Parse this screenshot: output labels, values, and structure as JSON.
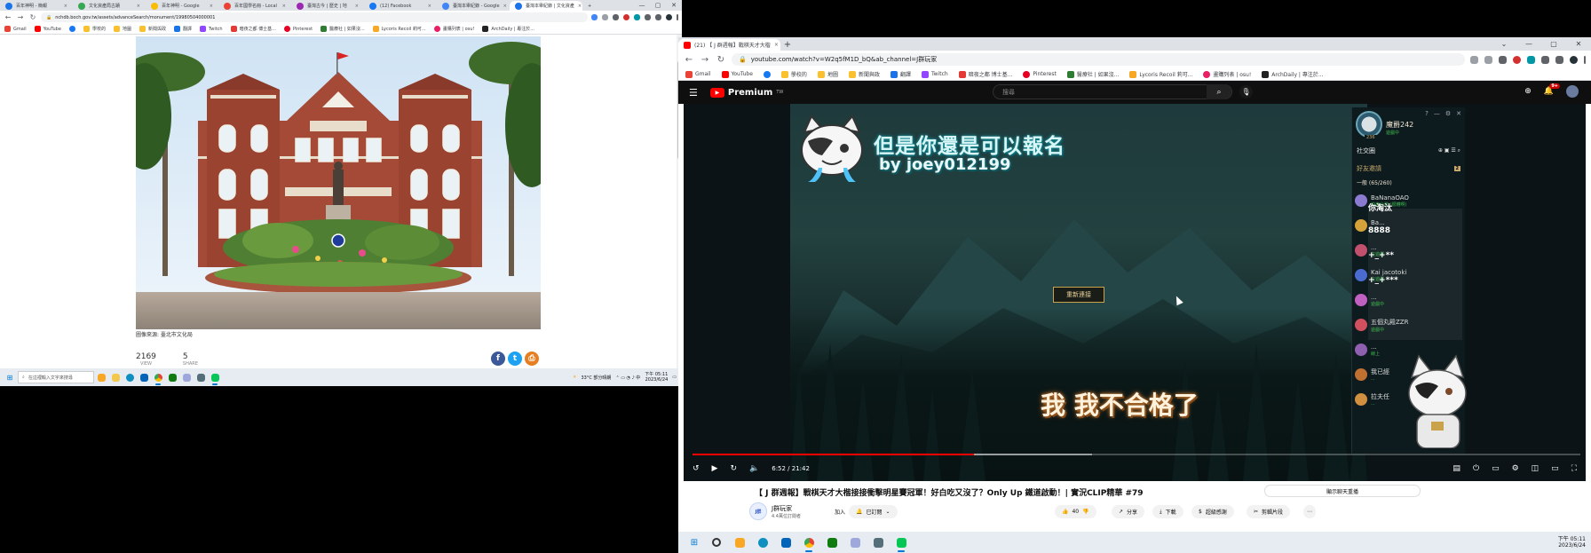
{
  "left": {
    "tabs": [
      {
        "label": "百年神明 - 簡報",
        "color": "#1a73e8",
        "active": false
      },
      {
        "label": "文化資產局古蹟",
        "color": "#34a853",
        "active": false
      },
      {
        "label": "百年神明 - Google",
        "color": "#fbbc04",
        "active": false
      },
      {
        "label": "百年國學名冊 - Local",
        "color": "#ea4335",
        "active": false
      },
      {
        "label": "臺灣古今 | 歷史 | 地",
        "color": "#9c27b0",
        "active": false
      },
      {
        "label": "(12) Facebook",
        "color": "#1877f2",
        "active": false
      },
      {
        "label": "臺灣本舉紀錄 - Google",
        "color": "#4285f4",
        "active": false
      },
      {
        "label": "臺灣本舉紀錄 | 文化資產",
        "color": "#1a73e8",
        "active": true
      }
    ],
    "url": "nchdb.boch.gov.tw/assets/advanceSearch/monument/19980504000001",
    "bookmarks": [
      {
        "label": "Gmail",
        "color": "#ea4335"
      },
      {
        "label": "YouTube",
        "color": "#ff0000"
      },
      {
        "label": "",
        "color": "#1877f2"
      },
      {
        "label": "學校的",
        "color": "#fbc02d"
      },
      {
        "label": "地圖",
        "color": "#fbc02d"
      },
      {
        "label": "新聞與政",
        "color": "#fbc02d"
      },
      {
        "label": "翻譯",
        "color": "#1a73e8"
      },
      {
        "label": "Twitch",
        "color": "#9146ff"
      },
      {
        "label": "暗夜之都 博士基...",
        "color": "#e53935"
      },
      {
        "label": "Pinterest",
        "color": "#e60023"
      },
      {
        "label": "醫療社 | 如果沒...",
        "color": "#2e7d32"
      },
      {
        "label": "Lycoris Recoil 莉可...",
        "color": "#f9a825"
      },
      {
        "label": "畫購列表 | osu!",
        "color": "#e91e63"
      },
      {
        "label": "ArchDaily | 專注於...",
        "color": "#222"
      }
    ],
    "caption": "圖像來源: 臺北市文化局",
    "views": {
      "value": "2169",
      "label": "VIEW"
    },
    "shares": {
      "value": "5",
      "label": "SHARE"
    },
    "taskbar": {
      "search_placeholder": "在這裡輸入文字來搜尋",
      "weather": "33°C 部分晴朗",
      "time": "下午 05:11",
      "date": "2023/6/24"
    }
  },
  "right": {
    "tab": {
      "label": "(21) 【 J 群週報】戰棋天才大楷",
      "active": true
    },
    "url": "youtube.com/watch?v=W2q5fM1D_bQ&ab_channel=J群玩家",
    "bookmarks": [
      {
        "label": "Gmail",
        "color": "#ea4335"
      },
      {
        "label": "YouTube",
        "color": "#ff0000"
      },
      {
        "label": "",
        "color": "#1877f2"
      },
      {
        "label": "學校的",
        "color": "#fbc02d"
      },
      {
        "label": "地圖",
        "color": "#fbc02d"
      },
      {
        "label": "新聞與政",
        "color": "#fbc02d"
      },
      {
        "label": "翻譯",
        "color": "#1a73e8"
      },
      {
        "label": "Twitch",
        "color": "#9146ff"
      },
      {
        "label": "暗夜之都 博士基...",
        "color": "#e53935"
      },
      {
        "label": "Pinterest",
        "color": "#e60023"
      },
      {
        "label": "醫療社 | 如果沒...",
        "color": "#2e7d32"
      },
      {
        "label": "Lycoris Recoil 莉可...",
        "color": "#f9a825"
      },
      {
        "label": "畫購列表 | osu!",
        "color": "#e91e63"
      },
      {
        "label": "ArchDaily | 專注於...",
        "color": "#222"
      }
    ],
    "youtube": {
      "logo_text": "Premium",
      "logo_region": "TW",
      "search_placeholder": "搜尋",
      "notifications_count": "9+",
      "video": {
        "subtitle_top": "但是你還是可以報名",
        "subtitle_by": "by joey012199",
        "subtitle_bottom": "我 我不合格了",
        "reconnect_label": "重新連接",
        "time": "6:52 / 21:42",
        "progress_played": 0.317,
        "progress_loaded": 0.45
      },
      "friends_panel": {
        "username": "魔爵242",
        "level": "236",
        "status": "遊戲中",
        "social_label": "社交圈",
        "invite_label": "好友邀請",
        "invite_count": "2",
        "group_label": "一般 (65/260)",
        "friends": [
          {
            "name": "BaNanaOAO",
            "sub": "快來台灣 (很糟啊)",
            "comment": "你淘汰",
            "color": "#8a7bd1"
          },
          {
            "name": "Ba...",
            "sub": "...",
            "comment": "8888",
            "color": "#d4a13a"
          },
          {
            "name": "...",
            "sub": "在遊戲",
            "comment": "+_+**",
            "color": "#c0506c"
          },
          {
            "name": "Kai jacotoki",
            "sub": "在遊戲",
            "comment": "+_+***",
            "color": "#4a6bd0"
          },
          {
            "name": "...",
            "sub": "遊戲中",
            "comment": "",
            "color": "#c060c0"
          },
          {
            "name": "五個丸殿ZZR",
            "sub": "遊戲中",
            "comment": "",
            "color": "#d05060"
          },
          {
            "name": "...",
            "sub": "線上",
            "comment": "",
            "color": "#9060b0"
          },
          {
            "name": "我已經",
            "sub": "...",
            "comment": "",
            "color": "#c07030"
          },
          {
            "name": "拉夫任",
            "sub": "...",
            "comment": "",
            "color": "#d09040"
          }
        ]
      },
      "title": "【 J 群週報】戰棋天才大楷接接衝擊明星賽冠軍！好白吃又沒了？Only Up 鐵道啟動！| 實況CLIP精華 #79",
      "channel": {
        "name": "J群玩家",
        "subs": "4.4萬位訂閱者",
        "avatar_text": "J群"
      },
      "join_label": "加入",
      "subscribed_label": "已訂閱",
      "likes": "40",
      "share_label": "分享",
      "download_label": "下載",
      "thanks_label": "超級感謝",
      "clip_label": "剪輯片段",
      "show_chat_label": "顯示聊天重播"
    },
    "taskbar": {
      "time": "下午 05:11",
      "date": "2023/6/24"
    }
  }
}
